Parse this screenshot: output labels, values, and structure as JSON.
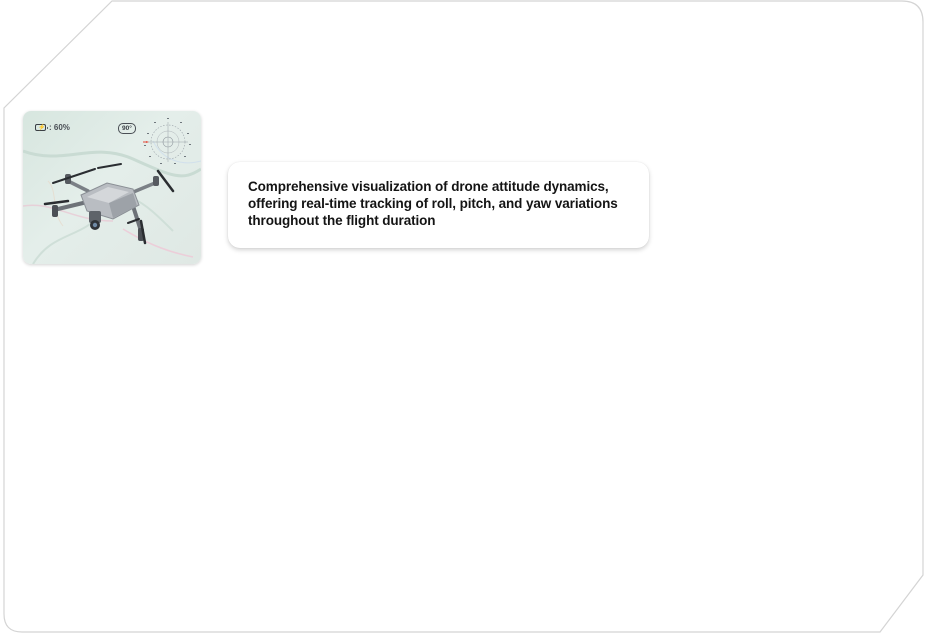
{
  "drone_card": {
    "battery_label": ": 60%",
    "battery_level": 0.6,
    "heading_label": "90°"
  },
  "caption": {
    "text": "Comprehensive visualization of drone attitude dynamics, offering real-time tracking of roll, pitch, and yaw variations throughout the flight duration"
  },
  "colors": {
    "map_background": "#dbe8e2",
    "caption_text": "#141414",
    "frame_border": "#d4d4d4",
    "compass_marker": "#e24b3b"
  },
  "icons": [
    "battery-icon",
    "compass-icon",
    "drone-image"
  ]
}
